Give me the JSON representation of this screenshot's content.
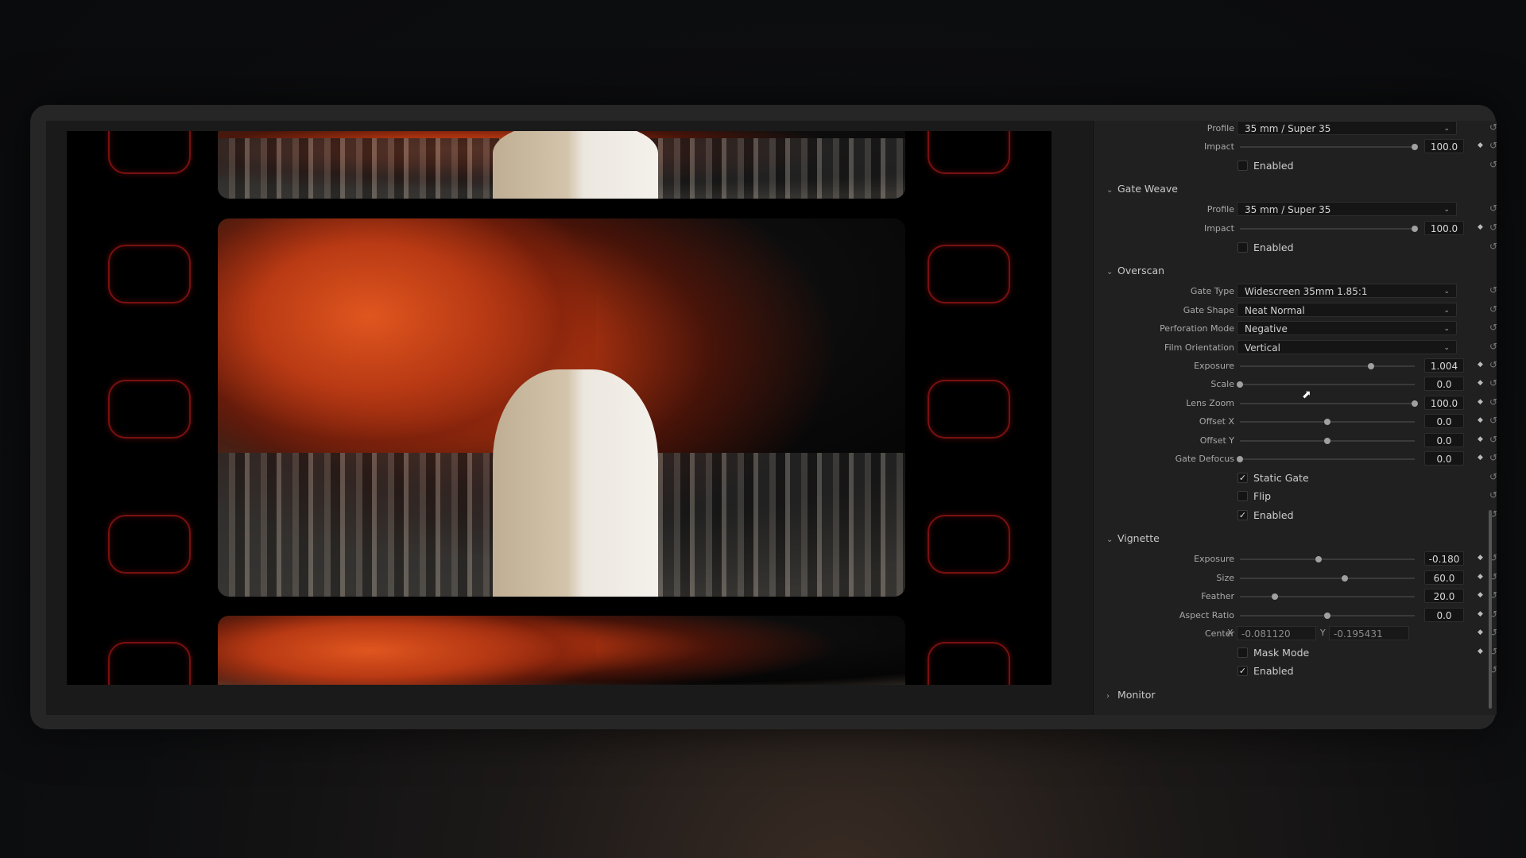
{
  "panel": {
    "section_top": {
      "profile_label": "Profile",
      "profile_value": "35 mm / Super 35",
      "impact_label": "Impact",
      "impact_value": "100.0",
      "impact_level": 1.0,
      "enabled_label": "Enabled",
      "enabled_checked": false
    },
    "gate_weave": {
      "title": "Gate Weave",
      "profile_label": "Profile",
      "profile_value": "35 mm / Super 35",
      "impact_label": "Impact",
      "impact_value": "100.0",
      "impact_level": 1.0,
      "enabled_label": "Enabled",
      "enabled_checked": false
    },
    "overscan": {
      "title": "Overscan",
      "gate_type_label": "Gate Type",
      "gate_type_value": "Widescreen 35mm 1.85:1",
      "gate_shape_label": "Gate Shape",
      "gate_shape_value": "Neat Normal",
      "perforation_label": "Perforation Mode",
      "perforation_value": "Negative",
      "orientation_label": "Film Orientation",
      "orientation_value": "Vertical",
      "exposure_label": "Exposure",
      "exposure_value": "1.004",
      "exposure_level": 0.75,
      "scale_label": "Scale",
      "scale_value": "0.0",
      "scale_level": 0.0,
      "lens_zoom_label": "Lens Zoom",
      "lens_zoom_value": "100.0",
      "lens_zoom_level": 1.0,
      "offset_x_label": "Offset X",
      "offset_x_value": "0.0",
      "offset_x_level": 0.5,
      "offset_y_label": "Offset Y",
      "offset_y_value": "0.0",
      "offset_y_level": 0.5,
      "gate_defocus_label": "Gate Defocus",
      "gate_defocus_value": "0.0",
      "gate_defocus_level": 0.0,
      "static_gate_label": "Static Gate",
      "static_gate_checked": true,
      "flip_label": "Flip",
      "flip_checked": false,
      "enabled_label": "Enabled",
      "enabled_checked": true
    },
    "vignette": {
      "title": "Vignette",
      "exposure_label": "Exposure",
      "exposure_value": "-0.180",
      "exposure_level": 0.45,
      "size_label": "Size",
      "size_value": "60.0",
      "size_level": 0.6,
      "feather_label": "Feather",
      "feather_value": "20.0",
      "feather_level": 0.2,
      "aspect_label": "Aspect Ratio",
      "aspect_value": "0.0",
      "aspect_level": 0.5,
      "center_label": "Center",
      "center_x_label": "X",
      "center_x_value": "-0.081120",
      "center_y_label": "Y",
      "center_y_value": "-0.195431",
      "mask_mode_label": "Mask Mode",
      "mask_mode_checked": false,
      "enabled_label": "Enabled",
      "enabled_checked": true
    },
    "monitor": {
      "title": "Monitor"
    }
  },
  "icons": {
    "chevron_open": "chevron-down-icon",
    "chevron_closed": "chevron-right-icon",
    "reset": "reset-icon",
    "keyframe": "keyframe-diamond-icon"
  }
}
